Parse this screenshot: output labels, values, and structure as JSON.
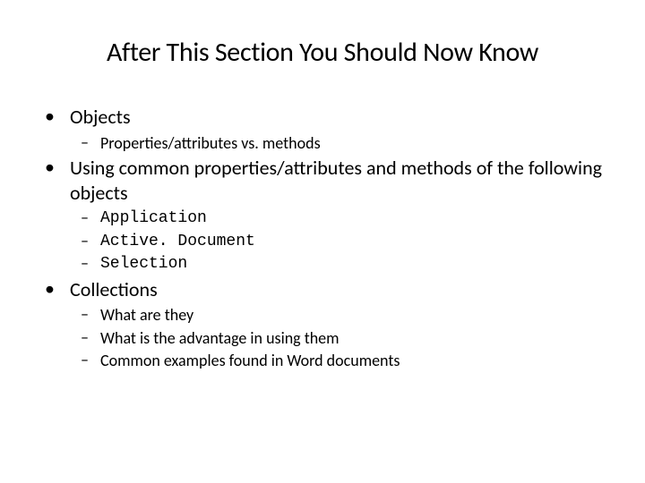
{
  "title": "After This Section You Should Now Know",
  "s1": {
    "heading": "Objects",
    "items": [
      "Properties/attributes vs. methods"
    ]
  },
  "s2": {
    "heading": "Using common properties/attributes and methods of the following objects",
    "items": [
      "Application",
      "Active. Document",
      "Selection"
    ]
  },
  "s3": {
    "heading": "Collections",
    "items": [
      "What are they",
      "What is the advantage in using them",
      "Common examples found in Word documents"
    ]
  },
  "bullets": {
    "lvl1": "•",
    "lvl2": "–"
  }
}
